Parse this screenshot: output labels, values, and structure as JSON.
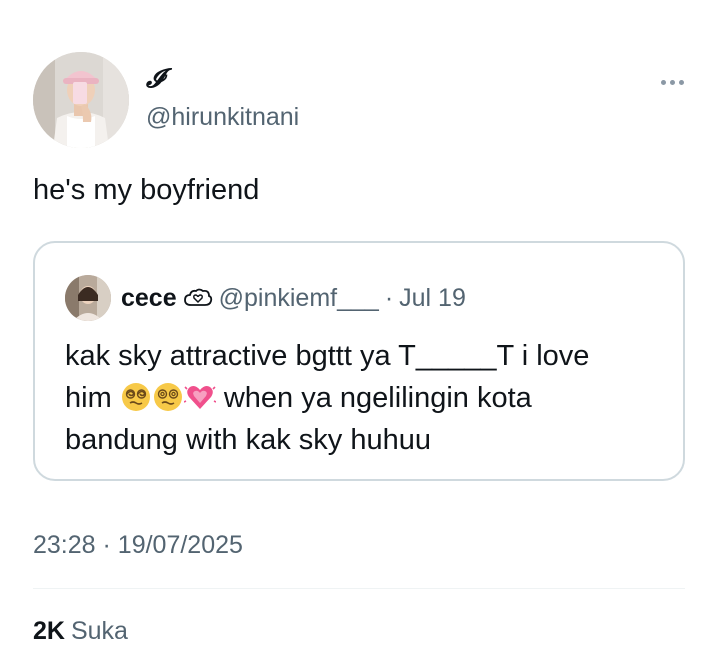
{
  "author": {
    "display_name": "𝓘",
    "handle": "@hirunkitnani"
  },
  "tweet": {
    "text": "he's my boyfriend"
  },
  "quote": {
    "name": "cece",
    "name_icon": "cloud-heart-icon",
    "handle": "@pinkiemf___",
    "separator": "·",
    "date": "Jul 19",
    "text_line1": "kak sky attractive bgttt ya T_____T i love",
    "text_line2_before": "him ",
    "text_line2_emojis": [
      "dizzy-face-emoji",
      "dizzy-face-emoji",
      "growing-heart-emoji"
    ],
    "text_line2_after": " when ya ngelilingin kota",
    "text_line3": "bandung with kak sky huhuu"
  },
  "meta": {
    "time": "23:28",
    "separator": "·",
    "date": "19/07/2025"
  },
  "stats": {
    "likes_count": "2K",
    "likes_label": "Suka"
  },
  "colors": {
    "text": "#0f1419",
    "secondary": "#536471",
    "border": "#cfd9de",
    "divider": "#eff3f4",
    "heart": "#f0508c"
  }
}
